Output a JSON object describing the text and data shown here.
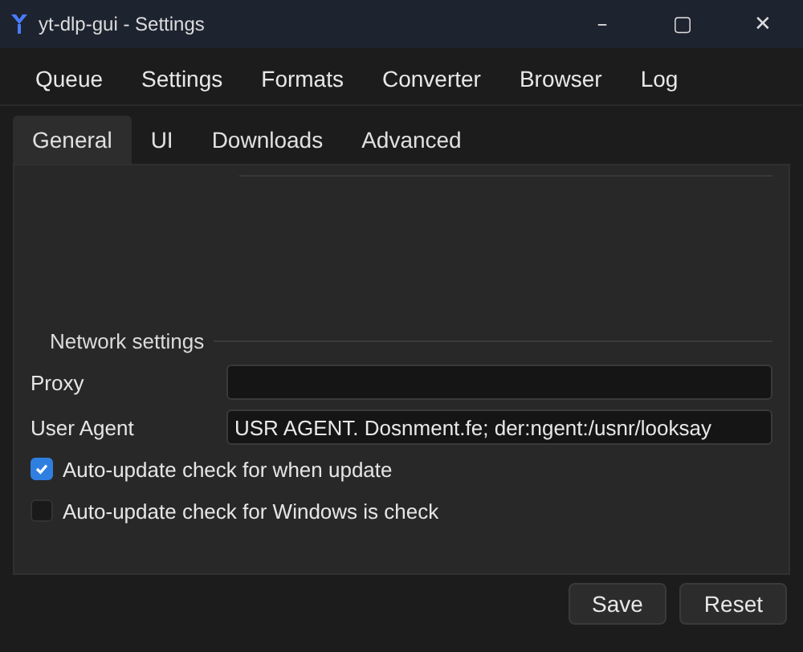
{
  "window": {
    "title": "yt-dlp-gui - Settings",
    "controls": [
      "–",
      "▢",
      "✕"
    ]
  },
  "menu": [
    "Queue",
    "Settings",
    "Formats",
    "Converter",
    "Browser",
    "Log"
  ],
  "tabs": [
    {
      "label": "General",
      "selected": true
    },
    {
      "label": "UI",
      "selected": false
    },
    {
      "label": "Downloads",
      "selected": false
    },
    {
      "label": "Advanced",
      "selected": false
    }
  ],
  "network_settings": {
    "title": "Network settings",
    "fields": [
      {
        "label": "Proxy"
      },
      {
        "label": "User Agent",
        "value": "USR AGENT. Dosnment.fe; der:ngent:/usnr/looksay"
      }
    ],
    "checkboxes": [
      {
        "label": "Auto-update check for when update",
        "checked": true
      },
      {
        "label": "Auto-update check for Windows is check",
        "checked": false
      }
    ]
  },
  "buttons": [
    "Save",
    "Reset"
  ]
}
